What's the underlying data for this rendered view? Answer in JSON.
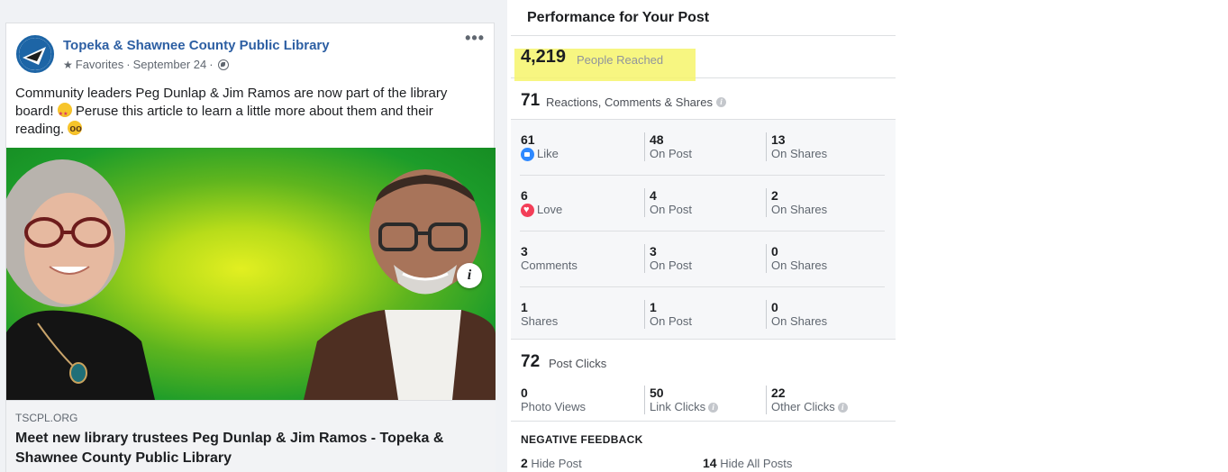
{
  "post": {
    "page_name": "Topeka & Shawnee County Public Library",
    "audience": "Favorites",
    "separator": "·",
    "date": "September 24",
    "text_line1": "Community leaders Peg Dunlap & Jim Ramos are now part of the library",
    "text_line2a": "board! ",
    "text_line2b": " Peruse this article to learn a little more about them and their",
    "text_line3": "reading. ",
    "link_domain": "TSCPL.ORG",
    "link_title": "Meet new library trustees Peg Dunlap & Jim Ramos - Topeka & Shawnee County Public Library",
    "more_icon": "more-horizontal-icon",
    "info_label": "i"
  },
  "performance": {
    "title": "Performance for Your Post",
    "reach": {
      "value": "4,219",
      "label": "People Reached"
    },
    "reactions": {
      "value": "71",
      "label": "Reactions, Comments & Shares"
    },
    "breakdown": [
      {
        "value": "61",
        "label": "Like",
        "icon": "like-icon",
        "post_value": "48",
        "post_label": "On Post",
        "shares_value": "13",
        "shares_label": "On Shares"
      },
      {
        "value": "6",
        "label": "Love",
        "icon": "love-icon",
        "post_value": "4",
        "post_label": "On Post",
        "shares_value": "2",
        "shares_label": "On Shares"
      },
      {
        "value": "3",
        "label": "Comments",
        "post_value": "3",
        "post_label": "On Post",
        "shares_value": "0",
        "shares_label": "On Shares"
      },
      {
        "value": "1",
        "label": "Shares",
        "post_value": "1",
        "post_label": "On Post",
        "shares_value": "0",
        "shares_label": "On Shares"
      }
    ],
    "clicks": {
      "value": "72",
      "label": "Post Clicks",
      "photo_views": "0",
      "photo_views_label": "Photo Views",
      "link_clicks": "50",
      "link_clicks_label": "Link Clicks",
      "other_clicks": "22",
      "other_clicks_label": "Other Clicks"
    },
    "negative": {
      "title": "NEGATIVE FEEDBACK",
      "hide_post_value": "2",
      "hide_post_label": "Hide Post",
      "hide_all_value": "14",
      "hide_all_label": "Hide All Posts"
    }
  },
  "colors": {
    "brand_blue": "#2d5fa3",
    "highlight": "#f6f56b",
    "like_blue": "#2d88ff",
    "love_red": "#f33e58"
  }
}
